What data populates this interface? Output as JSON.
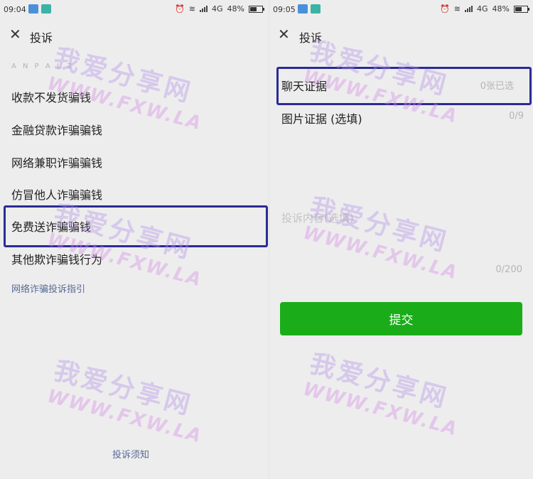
{
  "left": {
    "status": {
      "time": "09:04",
      "network": "4G",
      "battery": "48%"
    },
    "title": "投诉",
    "hint": "A  N  P  A  L  2",
    "reasons": [
      "收款不发货骗钱",
      "金融贷款诈骗骗钱",
      "网络兼职诈骗骗钱",
      "仿冒他人诈骗骗钱",
      "免费送诈骗骗钱",
      "其他欺诈骗钱行为"
    ],
    "guide_link": "网络诈骗投诉指引",
    "notice_link": "投诉须知"
  },
  "right": {
    "status": {
      "time": "09:05",
      "network": "4G",
      "battery": "48%"
    },
    "title": "投诉",
    "chat_evidence_label": "聊天证据",
    "chat_evidence_count": "0张已选",
    "image_evidence_label": "图片证据 (选填)",
    "image_evidence_count": "0/9",
    "content_placeholder": "投诉内容(选填)",
    "content_count": "0/200",
    "submit_label": "提交"
  },
  "watermark": {
    "line1": "我爱分享网",
    "line2": "WWW.FXW.LA"
  },
  "colors": {
    "accent_green": "#1aad19",
    "link_blue": "#576b95",
    "highlight_border": "#2b2b95",
    "watermark": "#b28fe8"
  },
  "icons": [
    "close-icon",
    "alarm-icon",
    "wifi-icon",
    "signal-icon",
    "battery-icon"
  ]
}
